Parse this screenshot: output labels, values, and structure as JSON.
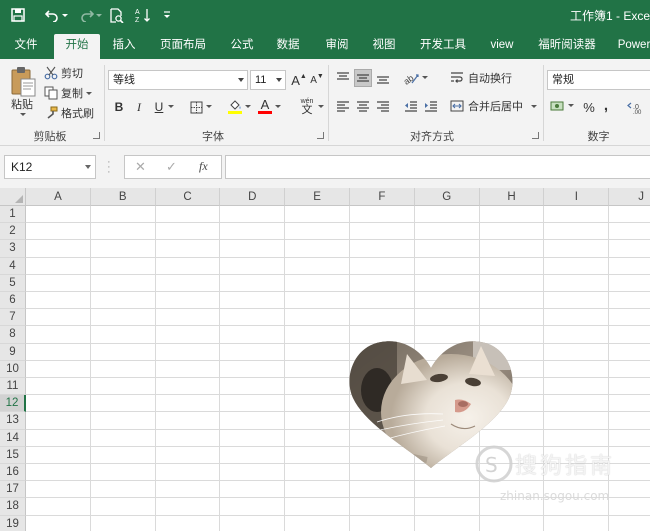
{
  "title_bar": {
    "title": "工作簿1 - Exce",
    "qat_items": [
      "save-icon",
      "undo-icon",
      "redo-icon",
      "print-preview-icon",
      "sort-icon",
      "customize-qat-icon"
    ]
  },
  "tabs": [
    {
      "label": "文件",
      "active": false
    },
    {
      "label": "开始",
      "active": true
    },
    {
      "label": "插入",
      "active": false
    },
    {
      "label": "页面布局",
      "active": false
    },
    {
      "label": "公式",
      "active": false
    },
    {
      "label": "数据",
      "active": false
    },
    {
      "label": "审阅",
      "active": false
    },
    {
      "label": "视图",
      "active": false
    },
    {
      "label": "开发工具",
      "active": false
    },
    {
      "label": "view",
      "active": false
    },
    {
      "label": "福昕阅读器",
      "active": false
    },
    {
      "label": "Power",
      "active": false
    }
  ],
  "ribbon": {
    "clipboard": {
      "group_label": "剪贴板",
      "paste_label": "粘贴",
      "cut_label": "剪切",
      "copy_label": "复制",
      "format_painter_label": "格式刷"
    },
    "font": {
      "group_label": "字体",
      "font_name": "等线",
      "font_size": "11",
      "bold": "B",
      "italic": "I",
      "underline": "U",
      "font_color": "#ff0000",
      "highlight_color": "#ffff00",
      "phonetic": "wén"
    },
    "alignment": {
      "group_label": "对齐方式",
      "wrap_text_label": "自动换行",
      "merge_center_label": "合并后居中"
    },
    "number": {
      "group_label": "数字",
      "format": "常规",
      "percent": "%",
      "comma": ","
    }
  },
  "formula_bar": {
    "name_box": "K12",
    "cancel": "✕",
    "enter": "✓",
    "fx": "fx",
    "formula": ""
  },
  "grid": {
    "columns": [
      "A",
      "B",
      "C",
      "D",
      "E",
      "F",
      "G",
      "H",
      "I",
      "J"
    ],
    "rows": [
      "1",
      "2",
      "3",
      "4",
      "5",
      "6",
      "7",
      "8",
      "9",
      "10",
      "11",
      "12",
      "13",
      "14",
      "15",
      "16",
      "17",
      "18",
      "19"
    ],
    "selected_row": "12"
  },
  "picture": {
    "shape": "heart",
    "subject": "cat-photo"
  },
  "watermark": {
    "text": "搜狗指南",
    "url": "zhinan.sogou.com"
  },
  "colors": {
    "excel_green": "#217346",
    "ribbon_bg": "#f3f3f3"
  }
}
